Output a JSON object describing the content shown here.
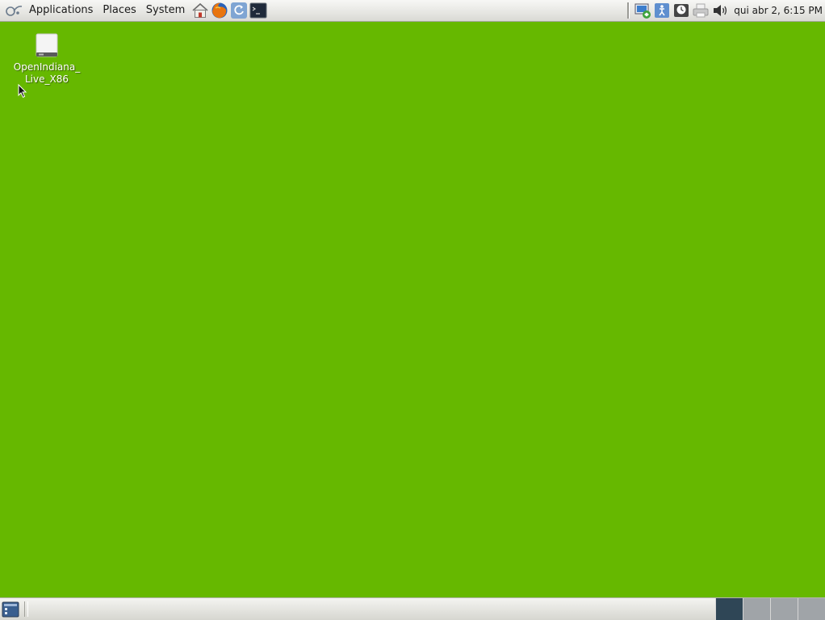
{
  "top_panel": {
    "menus": [
      "Applications",
      "Places",
      "System"
    ],
    "clock": "qui abr  2,  6:15 PM"
  },
  "desktop": {
    "icons": [
      {
        "label": "OpenIndiana_ Live_X86"
      }
    ],
    "background_color": "#66b800"
  },
  "bottom_panel": {
    "workspaces": 4,
    "active_workspace": 1
  }
}
